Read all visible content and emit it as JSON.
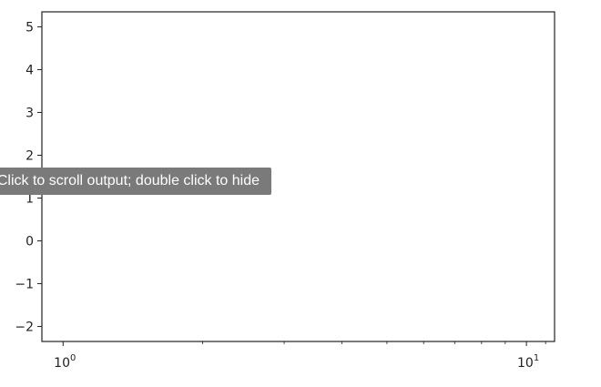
{
  "tooltip": {
    "text": "Click to scroll output; double click to hide"
  },
  "chart_data": {
    "type": "line",
    "title": "",
    "xlabel": "",
    "ylabel": "",
    "x_scale": "log",
    "xlim": [
      0.9,
      11.5
    ],
    "ylim": [
      -2.35,
      5.35
    ],
    "series": [],
    "grid": false,
    "yticks": [
      {
        "value": -2,
        "label": "−2"
      },
      {
        "value": -1,
        "label": "−1"
      },
      {
        "value": 0,
        "label": "0"
      },
      {
        "value": 1,
        "label": "1"
      },
      {
        "value": 2,
        "label": "2"
      },
      {
        "value": 3,
        "label": "3"
      },
      {
        "value": 4,
        "label": "4"
      },
      {
        "value": 5,
        "label": "5"
      }
    ],
    "xticks": [
      {
        "value": 1,
        "base": "10",
        "exponent": "0"
      },
      {
        "value": 10,
        "base": "10",
        "exponent": "1"
      }
    ],
    "x_minor_ticks": [
      2,
      3,
      4,
      5,
      6,
      7,
      8,
      9,
      11
    ]
  },
  "colors": {
    "axes": "#222222",
    "tooltip_bg": "#7a7a7a",
    "tooltip_text": "#ffffff"
  }
}
